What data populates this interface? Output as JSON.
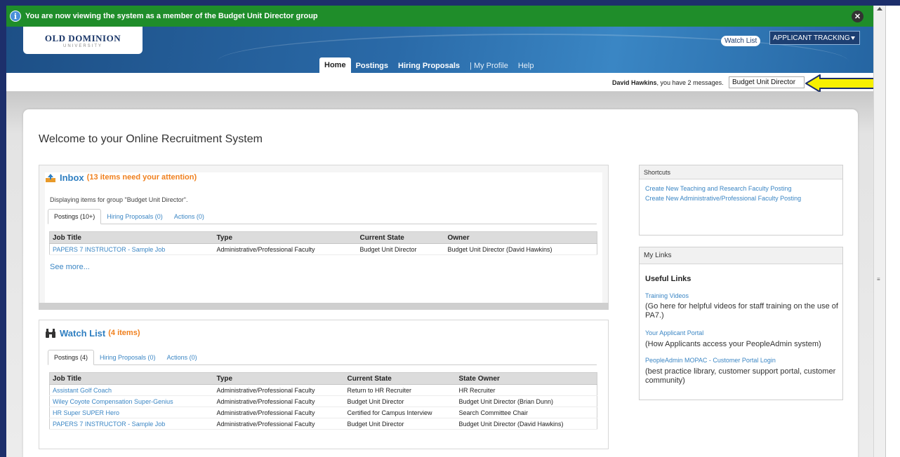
{
  "notice": {
    "text": "You are now viewing the system as a member of the Budget Unit Director group"
  },
  "header": {
    "logo_title": "OLD DOMINION",
    "logo_sub": "UNIVERSITY",
    "watch_list_button": "Watch List",
    "app_select": "APPLICANT TRACKING",
    "nav": [
      {
        "label": "Home",
        "active": true
      },
      {
        "label": "Postings",
        "active": false
      },
      {
        "label": "Hiring Proposals",
        "active": false
      },
      {
        "label": "| My Profile",
        "active": false
      },
      {
        "label": "Help",
        "active": false
      }
    ]
  },
  "userbar": {
    "user_name": "David Hawkins",
    "message_text": ", you have 2 messages.",
    "group_select": "Budget Unit Director"
  },
  "welcome": "Welcome to your Online Recruitment System",
  "inbox": {
    "title": "Inbox",
    "count": "(13 items need your attention)",
    "note": "Displaying items for group \"Budget Unit Director\".",
    "tabs": [
      "Postings (10+)",
      "Hiring Proposals (0)",
      "Actions (0)"
    ],
    "columns": [
      "Job Title",
      "Type",
      "Current State",
      "Owner"
    ],
    "rows": [
      [
        "PAPERS 7 INSTRUCTOR - Sample Job",
        "Administrative/Professional Faculty",
        "Budget Unit Director",
        "Budget Unit Director (David Hawkins)"
      ]
    ],
    "see_more": "See more..."
  },
  "watch_list": {
    "title": "Watch List",
    "count": "(4 items)",
    "tabs": [
      "Postings (4)",
      "Hiring Proposals (0)",
      "Actions (0)"
    ],
    "columns": [
      "Job Title",
      "Type",
      "Current State",
      "State Owner"
    ],
    "rows": [
      [
        "Assistant Golf Coach",
        "Administrative/Professional Faculty",
        "Return to HR Recruiter",
        "HR Recruiter"
      ],
      [
        "Wiley Coyote Compensation Super-Genius",
        "Administrative/Professional Faculty",
        "Budget Unit Director",
        "Budget Unit Director (Brian Dunn)"
      ],
      [
        "HR Super SUPER Hero",
        "Administrative/Professional Faculty",
        "Certified for Campus Interview",
        "Search Committee Chair"
      ],
      [
        "PAPERS 7 INSTRUCTOR - Sample Job",
        "Administrative/Professional Faculty",
        "Budget Unit Director",
        "Budget Unit Director (David Hawkins)"
      ]
    ]
  },
  "shortcuts": {
    "title": "Shortcuts",
    "links": [
      "Create New Teaching and Research Faculty Posting",
      "Create New Administrative/Professional Faculty Posting"
    ]
  },
  "my_links": {
    "title": "My Links",
    "heading": "Useful Links",
    "items": [
      {
        "link": "Training Videos",
        "desc": "(Go here for helpful videos for staff training on the use of PA7.)"
      },
      {
        "link": "Your Applicant Portal",
        "desc": "(How Applicants access your PeopleAdmin system)"
      },
      {
        "link": "PeopleAdmin MOPAC - Customer Portal Login",
        "desc": " (best practice library, customer support portal, customer community)"
      }
    ]
  },
  "colors": {
    "notice_green": "#1f8d2a",
    "header_blue": "#2a6aa8",
    "link_blue": "#3b86c4",
    "count_orange": "#f0801e",
    "arrow_yellow": "#f7f000"
  }
}
